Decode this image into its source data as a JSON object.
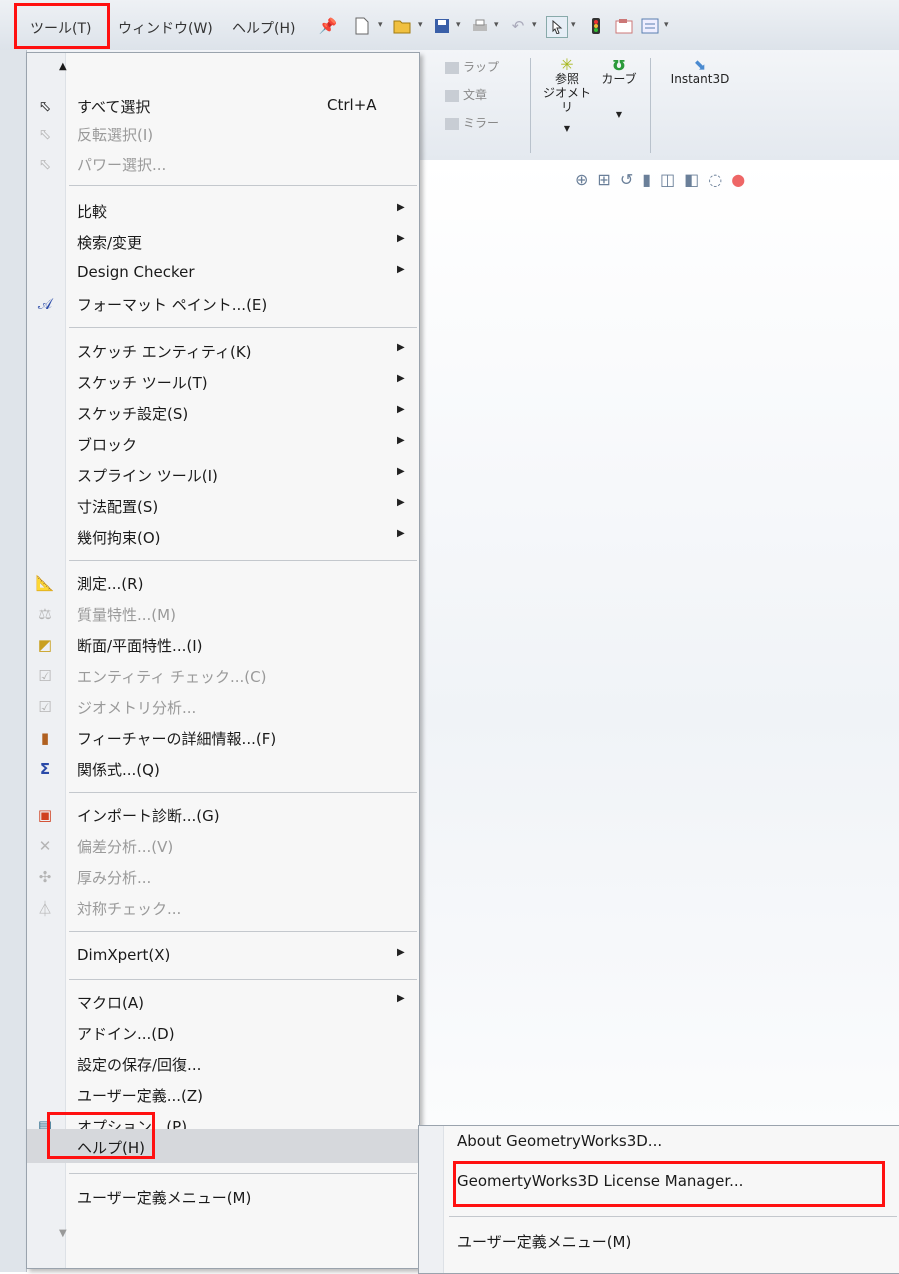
{
  "menubar": {
    "tools": "ツール(T)",
    "window": "ウィンドウ(W)",
    "help": "ヘルプ(H)"
  },
  "toolbar_icons": [
    "pin-icon",
    "new-document-icon",
    "open-folder-icon",
    "save-icon",
    "print-icon",
    "undo-icon",
    "select-icon",
    "traffic-light-icon",
    "options-icon",
    "customize-icon"
  ],
  "ribbon": {
    "group_small": [
      "ラップ",
      "文章",
      "ミラー"
    ],
    "reference_geometry": "参照\nジオメトリ",
    "curves": "カーブ",
    "instant3d": "Instant3D"
  },
  "menu": {
    "items": [
      {
        "label": "すべて選択",
        "shortcut": "Ctrl+A",
        "icon": "select-all-icon"
      },
      {
        "label": "反転選択(I)",
        "disabled": true,
        "icon": "invert-selection-icon"
      },
      {
        "label": "パワー選択...",
        "disabled": true,
        "icon": "power-select-icon"
      },
      {
        "label": "比較",
        "submenu": true
      },
      {
        "label": "検索/変更",
        "submenu": true
      },
      {
        "label": "Design Checker",
        "submenu": true
      },
      {
        "label": "フォーマット ペイント...(E)",
        "icon": "format-painter-icon"
      },
      {
        "label": "スケッチ エンティティ(K)",
        "submenu": true
      },
      {
        "label": "スケッチ ツール(T)",
        "submenu": true
      },
      {
        "label": "スケッチ設定(S)",
        "submenu": true
      },
      {
        "label": "ブロック",
        "submenu": true
      },
      {
        "label": "スプライン ツール(I)",
        "submenu": true
      },
      {
        "label": "寸法配置(S)",
        "submenu": true
      },
      {
        "label": "幾何拘束(O)",
        "submenu": true
      },
      {
        "label": "測定...(R)",
        "icon": "measure-icon"
      },
      {
        "label": "質量特性...(M)",
        "disabled": true,
        "icon": "mass-properties-icon"
      },
      {
        "label": "断面/平面特性...(I)",
        "icon": "section-properties-icon"
      },
      {
        "label": "エンティティ チェック...(C)",
        "disabled": true,
        "icon": "check-entity-icon"
      },
      {
        "label": "ジオメトリ分析...",
        "disabled": true,
        "icon": "geometry-analysis-icon"
      },
      {
        "label": "フィーチャーの詳細情報...(F)",
        "icon": "feature-statistics-icon"
      },
      {
        "label": "関係式...(Q)",
        "icon": "sigma-icon"
      },
      {
        "label": "インポート診断...(G)",
        "icon": "import-diagnostics-icon"
      },
      {
        "label": "偏差分析...(V)",
        "disabled": true,
        "icon": "deviation-analysis-icon"
      },
      {
        "label": "厚み分析...",
        "disabled": true,
        "icon": "thickness-analysis-icon"
      },
      {
        "label": "対称チェック...",
        "disabled": true,
        "icon": "symmetry-check-icon"
      },
      {
        "label": "DimXpert(X)",
        "submenu": true
      },
      {
        "label": "マクロ(A)",
        "submenu": true
      },
      {
        "label": "アドイン...(D)"
      },
      {
        "label": "設定の保存/回復..."
      },
      {
        "label": "ユーザー定義...(Z)"
      },
      {
        "label": "オプション...(P)",
        "icon": "options-icon"
      },
      {
        "label": "ヘルプ(H)"
      },
      {
        "label": "ユーザー定義メニュー(M)"
      }
    ]
  },
  "submenu": {
    "items": [
      "About GeometryWorks3D...",
      "GeomertyWorks3D License Manager...",
      "ユーザー定義メニュー(M)"
    ]
  },
  "colors": {
    "highlight_box": "#ff1010",
    "menu_bg": "#f7f7f7",
    "disabled_text": "#9a9a9a"
  }
}
